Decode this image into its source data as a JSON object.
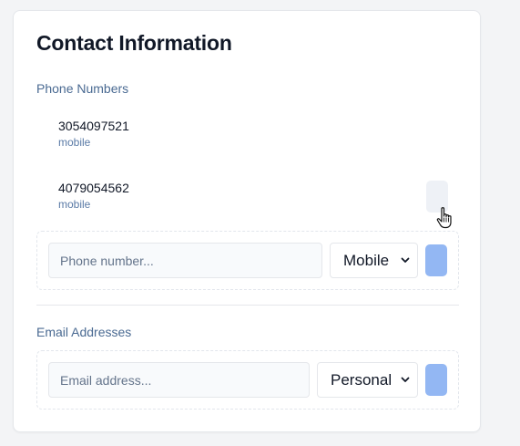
{
  "contact": {
    "title": "Contact Information",
    "phone_section_label": "Phone Numbers",
    "phones": [
      {
        "number": "3054097521",
        "type": "mobile"
      },
      {
        "number": "4079054562",
        "type": "mobile"
      }
    ],
    "phone_input_placeholder": "Phone number...",
    "phone_type_selected": "Mobile",
    "email_section_label": "Email Addresses",
    "email_input_placeholder": "Email address...",
    "email_type_selected": "Personal"
  },
  "colors": {
    "accent_button": "#93b7f3",
    "section_label": "#4a6a92",
    "remove_button": "#eef1f6"
  },
  "icons": [
    "chevron-down-icon",
    "hand-pointer-icon"
  ]
}
